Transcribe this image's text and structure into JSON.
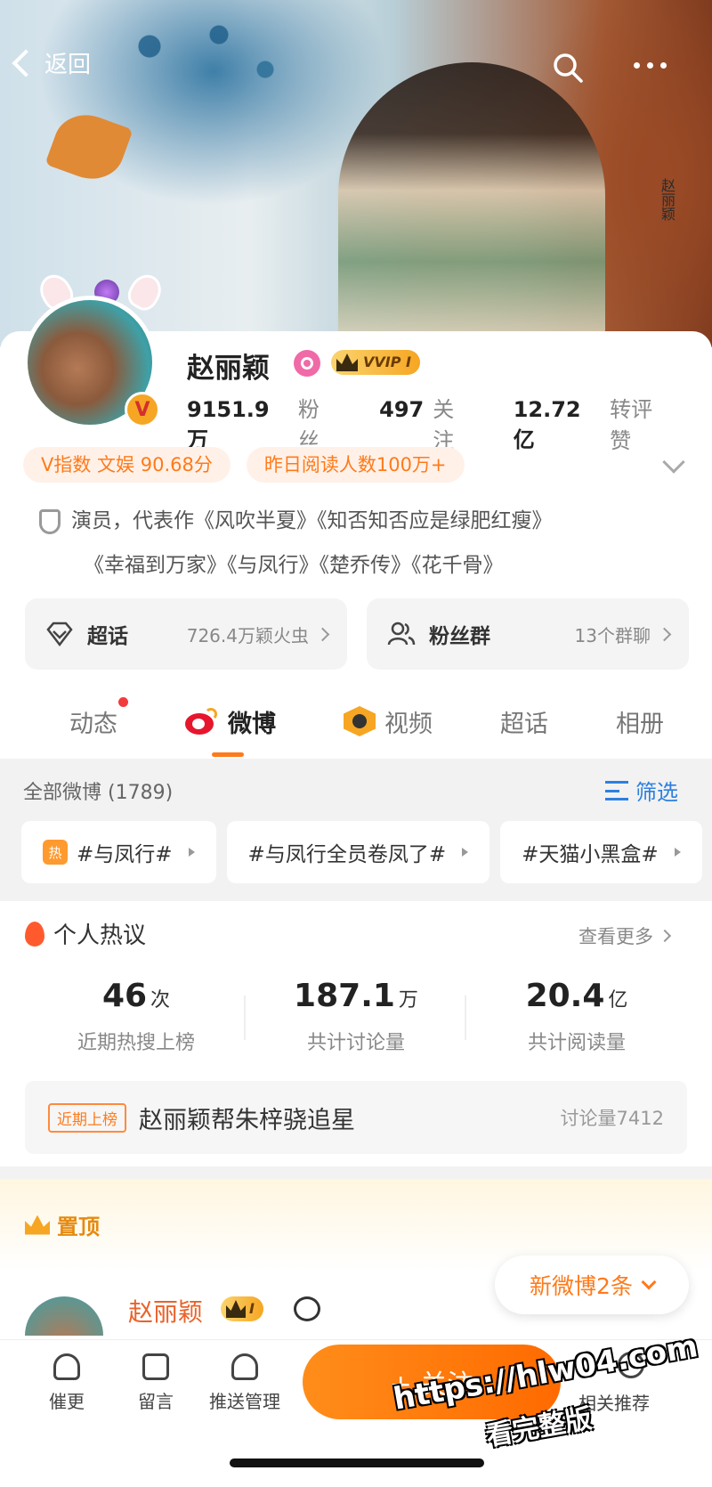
{
  "nav": {
    "back_label": "返回"
  },
  "cover": {
    "vertical_text": "赵丽颖"
  },
  "profile": {
    "name": "赵丽颖",
    "vip_label": "VVIP I",
    "v_badge": "V",
    "stats": [
      {
        "value": "9151.9万",
        "label": "粉丝"
      },
      {
        "value": "497",
        "label": "关注"
      },
      {
        "value": "12.72亿",
        "label": "转评赞"
      }
    ],
    "tags": [
      "V指数 文娱 90.68分",
      "昨日阅读人数100万+"
    ],
    "bio_line1": "演员，代表作《风吹半夏》《知否知否应是绿肥红瘦》",
    "bio_line2": "《幸福到万家》《与凤行》《楚乔传》《花千骨》"
  },
  "panels": [
    {
      "title": "超话",
      "sub": "726.4万颖火虫"
    },
    {
      "title": "粉丝群",
      "sub": "13个群聊"
    }
  ],
  "tabs": [
    "动态",
    "微博",
    "视频",
    "超话",
    "相册"
  ],
  "feed": {
    "all_label": "全部微博 (1789)",
    "filter_label": "筛选",
    "chips": [
      "#与凤行#",
      "#与凤行全员卷凤了#",
      "#天猫小黑盒#"
    ],
    "chip_hot_label": "热"
  },
  "hot": {
    "title": "个人热议",
    "more": "查看更多",
    "metrics": [
      {
        "num": "46",
        "unit": "次",
        "label": "近期热搜上榜"
      },
      {
        "num": "187.1",
        "unit": "万",
        "label": "共计讨论量"
      },
      {
        "num": "20.4",
        "unit": "亿",
        "label": "共计阅读量"
      }
    ],
    "trend_label": "近期上榜",
    "trend_topic": "赵丽颖帮朱梓骁追星",
    "trend_count": "讨论量7412"
  },
  "pinned": {
    "label": "置顶",
    "name": "赵丽颖",
    "badge": "I",
    "new_posts": "新微博2条"
  },
  "bottom": {
    "items": [
      "催更",
      "留言",
      "推送管理"
    ],
    "follow": "+ 关注",
    "recommend": "相关推荐"
  },
  "watermark": {
    "line1": "https://hlw04.com",
    "line2": "看完整版"
  },
  "colors": {
    "accent": "#ff7a1a",
    "link": "#2d7fe0",
    "weibo_red": "#e6162d"
  }
}
